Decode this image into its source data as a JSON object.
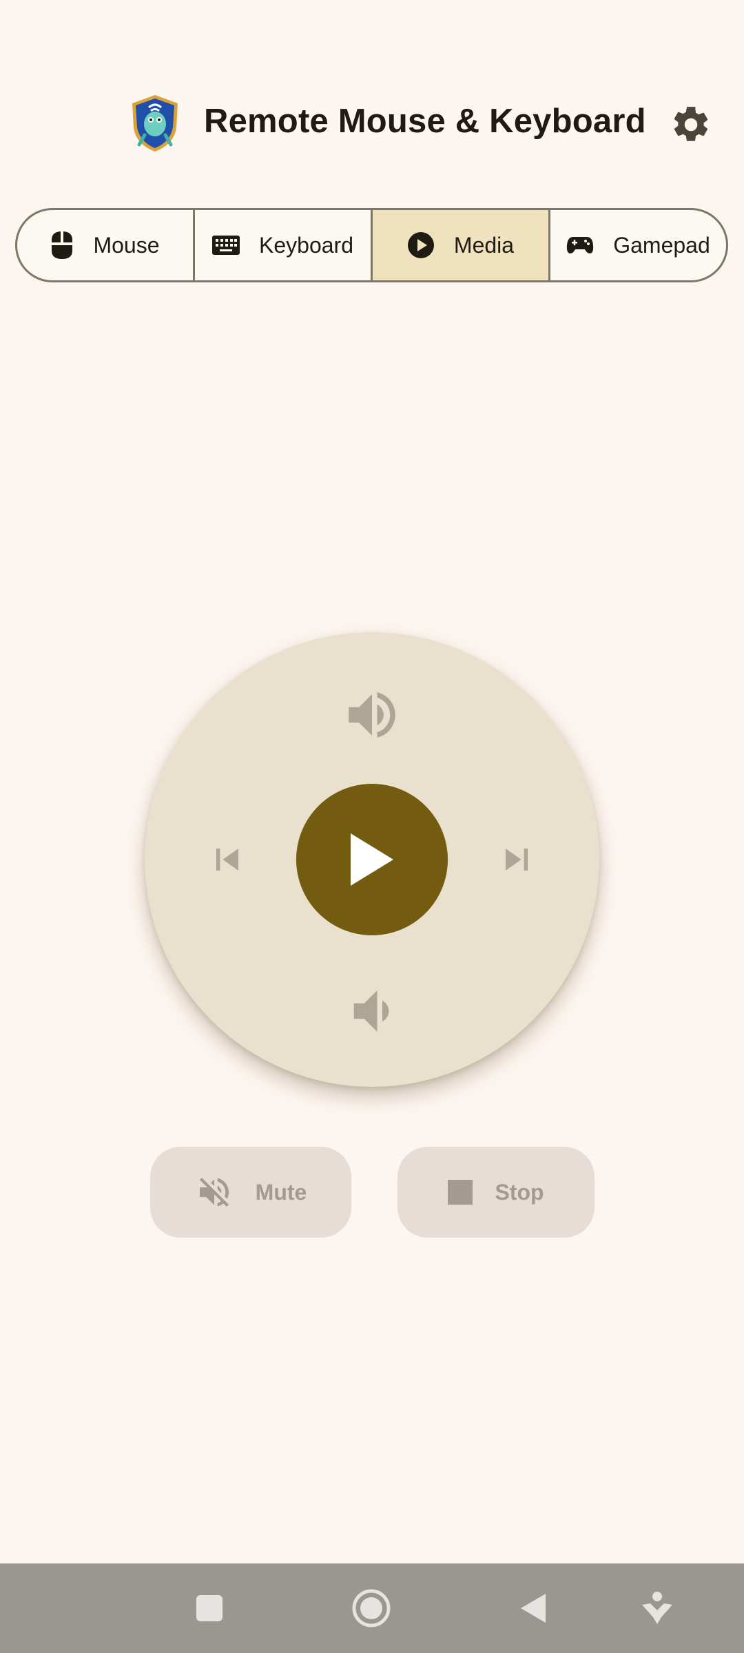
{
  "app": {
    "title": "Remote Mouse & Keyboard"
  },
  "header": {
    "logo_icon": "shield-mascot-logo",
    "settings_icon": "gear-icon"
  },
  "tabs": [
    {
      "label": "Mouse",
      "icon": "mouse-icon",
      "active": false
    },
    {
      "label": "Keyboard",
      "icon": "keyboard-icon",
      "active": false
    },
    {
      "label": "Media",
      "icon": "play-circle-icon",
      "active": true
    },
    {
      "label": "Gamepad",
      "icon": "gamepad-icon",
      "active": false
    }
  ],
  "media": {
    "controls": [
      "volume-up-icon",
      "previous-track-icon",
      "play-icon",
      "next-track-icon",
      "volume-down-icon"
    ],
    "mute_label": "Mute",
    "stop_label": "Stop"
  },
  "navbar": {
    "buttons": [
      "recents-square-icon",
      "home-circle-icon",
      "back-triangle-icon",
      "accessibility-icon"
    ]
  },
  "colors": {
    "background": "#FDF6F0",
    "accent": "#735C10",
    "active_tab": "#F0E2BE",
    "dial": "#E9E0CD",
    "disabled_icon": "#AFA597"
  }
}
